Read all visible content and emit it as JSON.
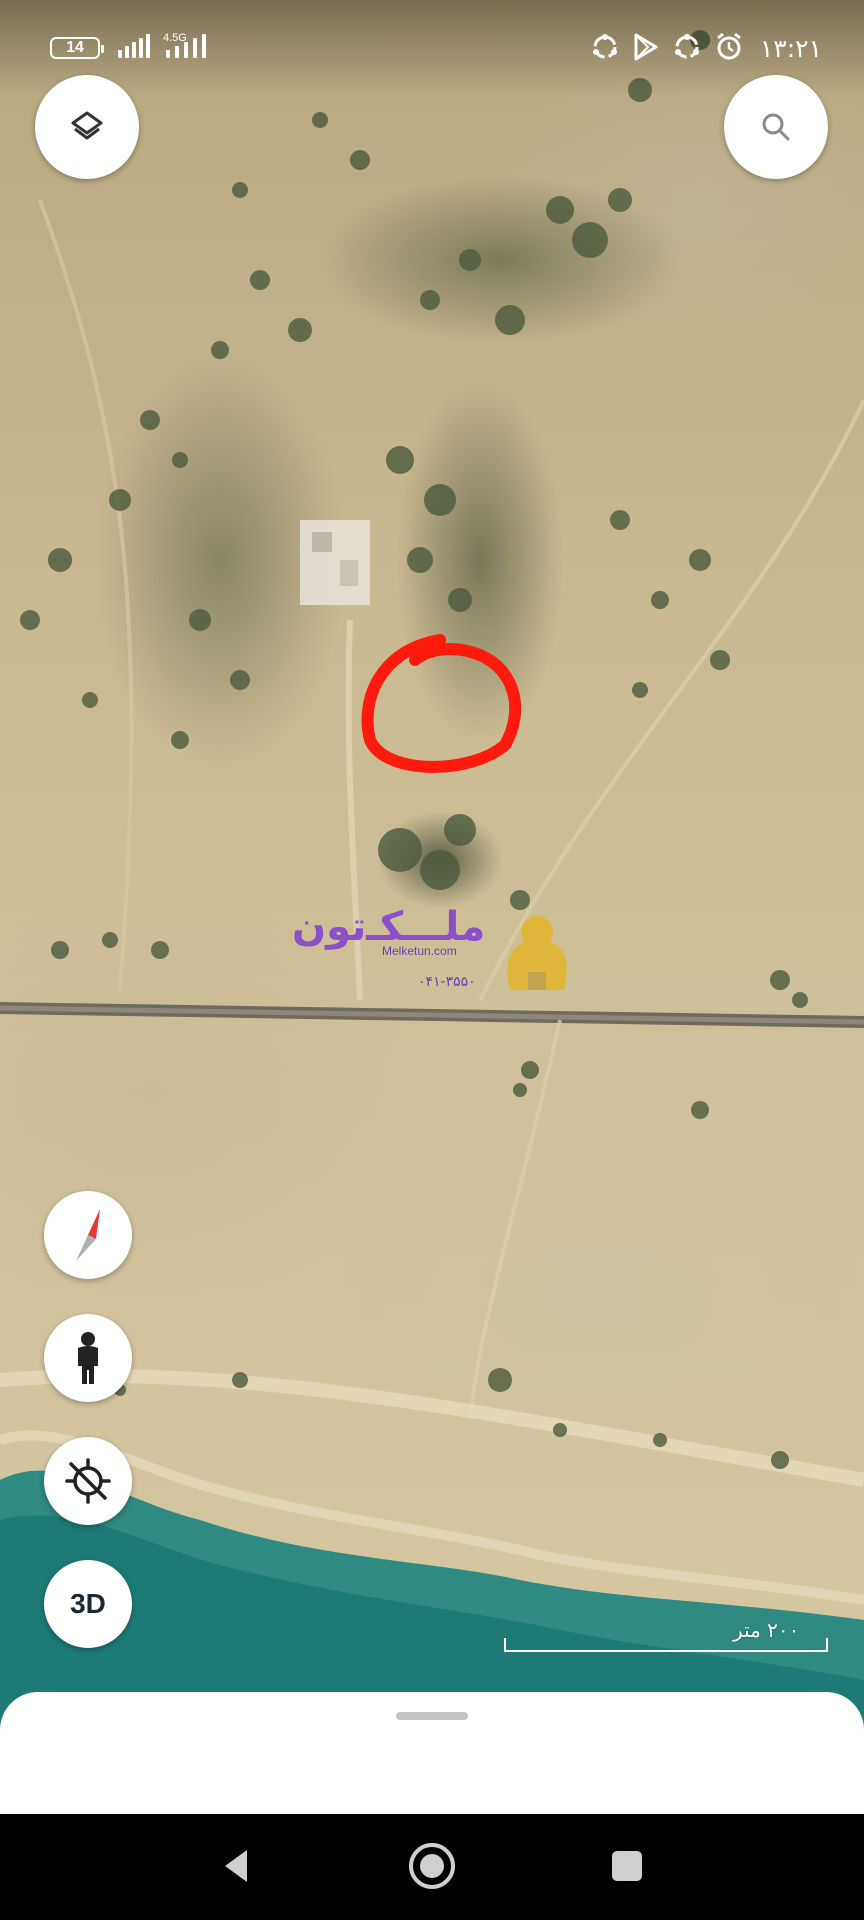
{
  "status_bar": {
    "battery": "14",
    "network": "4.5G",
    "time": "۱۳:۲۱",
    "icons": [
      "sync-icon",
      "play-store-icon",
      "sync-icon",
      "alarm-icon"
    ]
  },
  "map": {
    "type": "satellite",
    "highlight_color": "#ff1a0e",
    "water_color": "#1d7a74"
  },
  "buttons": {
    "layers": "layers-icon",
    "search": "search-icon",
    "compass": "compass-icon",
    "street_view": "pegman-icon",
    "location": "location-off-icon",
    "three_d_label": "3D"
  },
  "watermark": {
    "name": "ملـــکـ‌تون",
    "url": "Melketun.com",
    "phone": "۰۴۱-۳۵۵۰",
    "logo_color": "#e4b52b"
  },
  "scale": {
    "label": "۲۰۰ متر"
  },
  "bottom_sheet": {
    "handle": "drag-handle"
  },
  "nav_bar": {
    "back": "back-icon",
    "home": "home-icon",
    "recents": "recents-icon"
  }
}
